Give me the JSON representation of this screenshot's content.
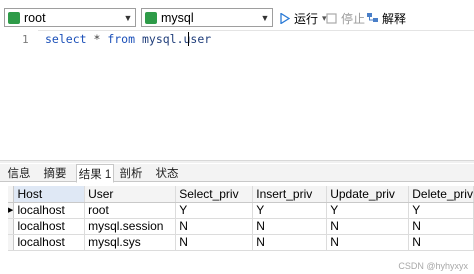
{
  "toolbar": {
    "connection": "root",
    "database": "mysql",
    "run_label": "运行",
    "run_dropdown": "▾",
    "stop_label": "停止",
    "explain_label": "解释",
    "colors": {
      "connection_icon": "#2e9b48",
      "database_icon": "#2e9b48",
      "run_icon": "#2a7ad6"
    }
  },
  "editor": {
    "line_number": "1",
    "code": {
      "select": "select",
      "star": " * ",
      "from": "from",
      "space": " ",
      "table": "mysql.user"
    }
  },
  "result_tabs": [
    "信息",
    "摘要",
    "结果 1",
    "剖析",
    "状态"
  ],
  "active_tab": "结果 1",
  "grid": {
    "columns": [
      "Host",
      "User",
      "Select_priv",
      "Insert_priv",
      "Update_priv",
      "Delete_priv"
    ],
    "rows": [
      [
        "localhost",
        "root",
        "Y",
        "Y",
        "Y",
        "Y"
      ],
      [
        "localhost",
        "mysql.session",
        "N",
        "N",
        "N",
        "N"
      ],
      [
        "localhost",
        "mysql.sys",
        "N",
        "N",
        "N",
        "N"
      ]
    ],
    "current_row_marker": "▶"
  },
  "watermark": "CSDN @hyhyxyx"
}
